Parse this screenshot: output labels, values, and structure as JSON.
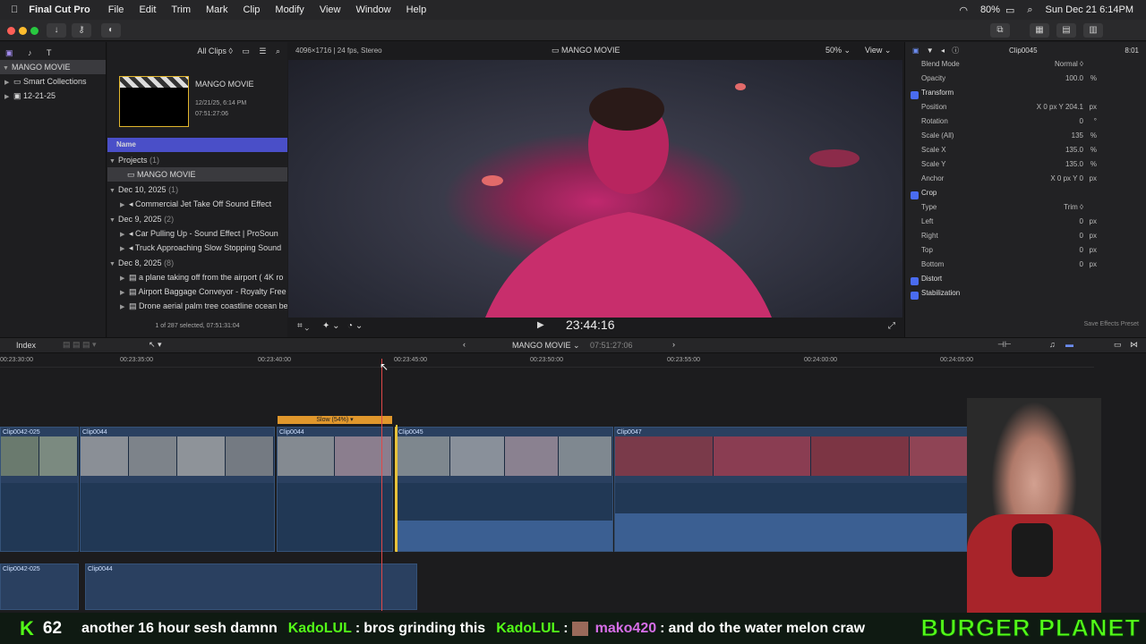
{
  "menubar": {
    "app": "Final Cut Pro",
    "items": [
      "File",
      "Edit",
      "Trim",
      "Mark",
      "Clip",
      "Modify",
      "View",
      "Window",
      "Help"
    ],
    "battery": "80%",
    "datetime": "Sun Dec 21  6:14PM"
  },
  "library": {
    "name": "MANGO MOVIE",
    "items": [
      "Smart Collections",
      "12-21-25"
    ]
  },
  "browser": {
    "filter": "All Clips",
    "project_name": "MANGO MOVIE",
    "project_date": "12/21/25, 6:14 PM",
    "project_duration": "07:51:27:06",
    "column": "Name",
    "status": "1 of 287 selected, 07:51:31:04",
    "groups": [
      {
        "label": "Projects",
        "count": "(1)",
        "items": [
          "MANGO MOVIE"
        ]
      },
      {
        "label": "Dec 10, 2025",
        "count": "(1)",
        "items": [
          "Commercial Jet Take Off Sound Effect"
        ]
      },
      {
        "label": "Dec 9, 2025",
        "count": "(2)",
        "items": [
          "Car Pulling Up - Sound Effect  |  ProSoun",
          "Truck Approaching Slow Stopping Sound"
        ]
      },
      {
        "label": "Dec 8, 2025",
        "count": "(8)",
        "items": [
          "a plane taking off from the airport ( 4K ro",
          "Airport Baggage Conveyor - Royalty Free",
          "Drone aerial palm tree coastline ocean be"
        ]
      }
    ]
  },
  "viewer": {
    "format": "4096×1716 | 24 fps, Stereo",
    "title": "MANGO MOVIE",
    "zoom": "50%",
    "view": "View",
    "timecode": "23:44:16"
  },
  "inspector": {
    "clip": "Clip0045",
    "duration": "8:01",
    "rows": [
      {
        "label": "Blend Mode",
        "value": "Normal ◊",
        "unit": ""
      },
      {
        "label": "Opacity",
        "value": "100.0",
        "unit": "%"
      },
      {
        "label": "Transform",
        "value": "",
        "unit": "",
        "section": true
      },
      {
        "label": "Position",
        "value": "X  0 px   Y  204.1",
        "unit": "px"
      },
      {
        "label": "Rotation",
        "value": "0",
        "unit": "°"
      },
      {
        "label": "Scale (All)",
        "value": "135",
        "unit": "%"
      },
      {
        "label": "Scale X",
        "value": "135.0",
        "unit": "%"
      },
      {
        "label": "Scale Y",
        "value": "135.0",
        "unit": "%"
      },
      {
        "label": "Anchor",
        "value": "X  0 px   Y  0",
        "unit": "px"
      },
      {
        "label": "Crop",
        "value": "",
        "unit": "",
        "section": true
      },
      {
        "label": "Type",
        "value": "Trim ◊",
        "unit": ""
      },
      {
        "label": "Left",
        "value": "0",
        "unit": "px"
      },
      {
        "label": "Right",
        "value": "0",
        "unit": "px"
      },
      {
        "label": "Top",
        "value": "0",
        "unit": "px"
      },
      {
        "label": "Bottom",
        "value": "0",
        "unit": "px"
      },
      {
        "label": "Distort",
        "value": "",
        "unit": "",
        "section": true
      },
      {
        "label": "Stabilization",
        "value": "",
        "unit": "",
        "section": true
      }
    ],
    "save_preset": "Save Effects Preset"
  },
  "timebar": {
    "index": "Index",
    "project": "MANGO MOVIE",
    "duration": "07:51:27:06"
  },
  "timeline": {
    "ticks": [
      "00:23:30:00",
      "00:23:35:00",
      "00:23:40:00",
      "00:23:45:00",
      "00:23:50:00",
      "00:23:55:00",
      "00:24:00:00",
      "00:24:05:00"
    ],
    "retime": "Slow (54%) ▾",
    "clips": [
      "Clip0042-025",
      "Clip0044",
      "Clip0044",
      "Clip0045",
      "Clip0047"
    ],
    "lower_clips": [
      "Clip0042-025",
      "Clip0044"
    ]
  },
  "ticker": {
    "count": "62",
    "messages": [
      "another 16 hour sesh damnn",
      "KadoLUL",
      "bros grinding this",
      "KadoLUL",
      "mako420",
      "and do the water melon craw"
    ],
    "brand": "BURGER PLANET"
  }
}
